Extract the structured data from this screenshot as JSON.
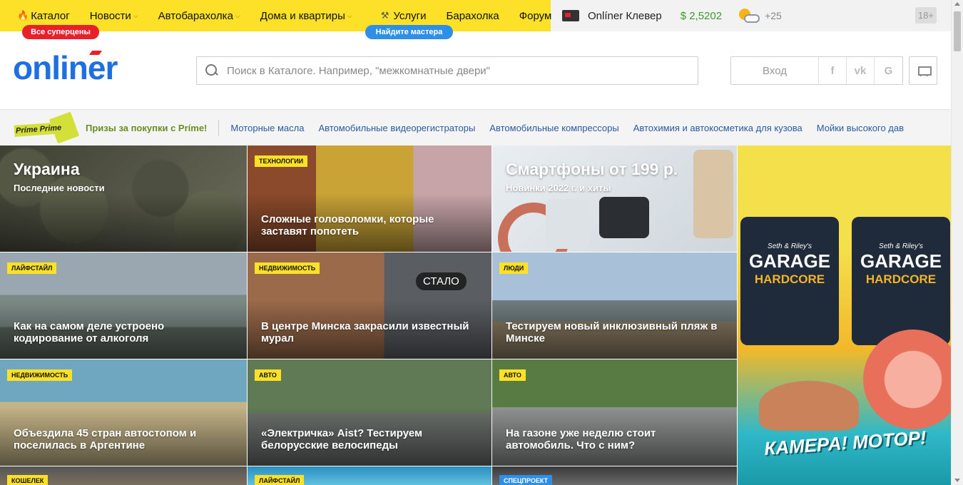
{
  "topnav": {
    "items": [
      {
        "label": "Каталог",
        "icon": "fire-icon"
      },
      {
        "label": "Новости",
        "dropdown": true
      },
      {
        "label": "Автобарахолка",
        "dropdown": true
      },
      {
        "label": "Дома и квартиры",
        "dropdown": true
      },
      {
        "label": "Услуги",
        "icon": "hammer-icon"
      },
      {
        "label": "Барахолка"
      },
      {
        "label": "Форум"
      }
    ],
    "badge_catalog": "Все суперцены",
    "badge_services": "Найдите мастера",
    "clever": "Onlíner Клевер",
    "currency": "$ 2,5202",
    "temperature": "+25",
    "age": "18+"
  },
  "header": {
    "logo": "onliner",
    "search_placeholder": "Поиск в Каталоге. Например, \"межкомнатные двери\"",
    "login": "Вход",
    "social": [
      "f",
      "vk",
      "G"
    ]
  },
  "strip": {
    "prime_badge": "Príme Prime",
    "prime_text": "Призы за покупки с Príme!",
    "links": [
      "Моторные масла",
      "Автомобильные видеорегистраторы",
      "Автомобильные компрессоры",
      "Автохимия и автокосметика для кузова",
      "Мойки высокого дав"
    ]
  },
  "tiles": [
    {
      "title": "Украина",
      "subtitle": "Последние новости"
    },
    {
      "tag": "ТЕХНОЛОГИИ",
      "title": "Сложные головоломки, которые заставят попотеть"
    },
    {
      "title": "Смартфоны от 199 р.",
      "subtitle": "Новинки 2022 г. и хиты"
    },
    {
      "tag": "ЛАЙФСТАЙЛ",
      "title": "Как на самом деле устроено кодирование от алкоголя"
    },
    {
      "tag": "НЕДВИЖИМОСТЬ",
      "title": "В центре Минска закрасили известный мурал",
      "overlay": "СТАЛО"
    },
    {
      "tag": "ЛЮДИ",
      "title": "Тестируем новый инклюзивный пляж в Минске"
    },
    {
      "tag": "НЕДВИЖИМОСТЬ",
      "title": "Объездила 45 стран автостопом и поселилась в Аргентине"
    },
    {
      "tag": "АВТО",
      "title": "«Электричка» Aist? Тестируем белорусские велосипеды"
    },
    {
      "tag": "АВТО",
      "title": "На газоне уже неделю стоит автомобиль. Что с ним?"
    },
    {
      "tag": "КОШЕЛЕК"
    },
    {
      "tag": "ЛАЙФСТАЙЛ"
    },
    {
      "tag": "СПЕЦПРОЕКТ"
    }
  ],
  "ad": {
    "brand_small": "Seth & Riley's",
    "brand": "GARAGE",
    "brand_sub": "HARDCORE",
    "slogan": "КАМЕРА! МОТОР!"
  }
}
